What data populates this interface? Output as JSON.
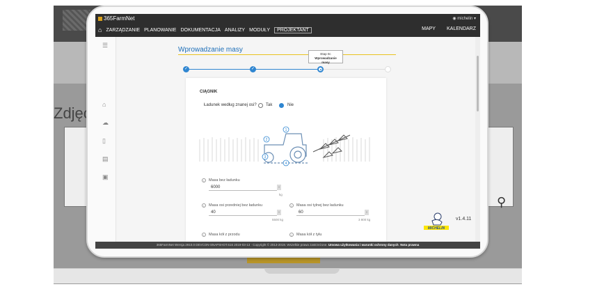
{
  "background": {
    "heading": "Zdjęcia"
  },
  "app": {
    "brand": "365FarmNet",
    "user": "michelin"
  },
  "nav": {
    "items": [
      "ZARZĄDZANIE",
      "PLANOWANIE",
      "DOKUMENTACJA",
      "ANALIZY",
      "MODUŁY",
      "PROJEKTANT"
    ],
    "right": [
      "MAPY",
      "KALENDARZ"
    ]
  },
  "page": {
    "title": "Wprowadzanie masy",
    "tooltip_line1": "Etap 0c",
    "tooltip_line2": "Wprowadzanie",
    "tooltip_line3": "masy"
  },
  "form": {
    "section": "CIĄGNIK",
    "question": "Ładunek według znanej osi?",
    "option_yes": "Tak",
    "option_no": "Nie",
    "selected": "Nie",
    "diagram_labels": [
      "1",
      "2",
      "3",
      "4"
    ],
    "fields": [
      {
        "label": "Masa bez ładunku",
        "value": "6000",
        "unit": "kg"
      },
      {
        "label": "Masa osi przedniej bez ładunku",
        "value": "40",
        "unit": "5500 kg"
      },
      {
        "label": "Masa osi tylnej bez ładunku",
        "value": "60",
        "unit": "3 800 kg"
      },
      {
        "label": "Masa kół z przodu",
        "value": "",
        "unit": ""
      },
      {
        "label": "Masa kół z tyłu",
        "value": "",
        "unit": ""
      }
    ]
  },
  "brand_logo": "MICHELIN",
  "version": "v1.4.11",
  "footer": {
    "text": "365FarmNet Wersja 2910.0 DEVCON-SNAPSHOT.616 2019-03-13 · Copyright © 2013-2019. Wszelkie prawa zastrzeżone.",
    "link1": "Umowa użytkowania i warunki ochrony danych",
    "link2": "Nota prawna"
  }
}
